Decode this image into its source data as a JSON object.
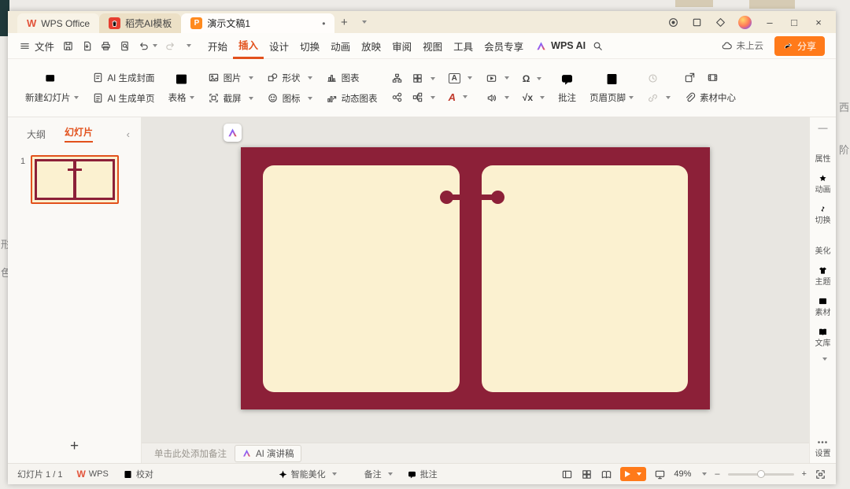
{
  "titlebar": {
    "tabs": [
      {
        "label": "WPS Office"
      },
      {
        "label": "稻壳AI模板"
      },
      {
        "label": "演示文稿1",
        "modified_dot": "•"
      }
    ],
    "new_tab": "+",
    "controls": {
      "minimize": "–",
      "maximize": "□",
      "close": "×"
    }
  },
  "menubar": {
    "file": "文件",
    "menus": [
      "开始",
      "插入",
      "设计",
      "切换",
      "动画",
      "放映",
      "审阅",
      "视图",
      "工具",
      "会员专享"
    ],
    "active_menu": "插入",
    "wps_ai": "WPS AI",
    "cloud_status": "未上云",
    "share": "分享"
  },
  "ribbon": {
    "new_slide": "新建幻灯片",
    "ai_cover": "AI 生成封面",
    "ai_single": "AI 生成单页",
    "table": "表格",
    "picture": "图片",
    "screenshot": "截屏",
    "shapes": "形状",
    "icon_library": "图标",
    "chart": "图表",
    "dynamic_chart": "动态图表",
    "textbox_glyph": "A",
    "wordart_glyph": "A",
    "omega_glyph": "Ω",
    "sqrt_glyph": "√x",
    "comment": "批注",
    "header_footer": "页眉页脚",
    "material_center": "素材中心"
  },
  "slides_panel": {
    "outline_tab": "大纲",
    "slides_tab": "幻灯片",
    "collapse_glyph": "‹",
    "slide_number": "1",
    "add_slide_glyph": "+"
  },
  "canvas": {
    "slide_bg_color": "#8c2038",
    "page_color": "#fbf1d0"
  },
  "notes_bar": {
    "placeholder": "单击此处添加备注",
    "ai_speech": "AI 演讲稿"
  },
  "right_sidebar": {
    "items": [
      "属性",
      "动画",
      "切换",
      "美化",
      "主题",
      "素材",
      "文库"
    ],
    "settings": "设置"
  },
  "statusbar": {
    "slide_counter": "幻灯片 1 / 1",
    "wps_badge": "WPS",
    "proofread": "校对",
    "smart_beautify": "智能美化",
    "notes": "备注",
    "comment": "批注",
    "zoom_level": "49%",
    "zoom_out": "–",
    "zoom_in": "+"
  },
  "background": {
    "left_chars": [
      "形",
      "色"
    ],
    "right_chars": [
      "西",
      "阶"
    ]
  }
}
